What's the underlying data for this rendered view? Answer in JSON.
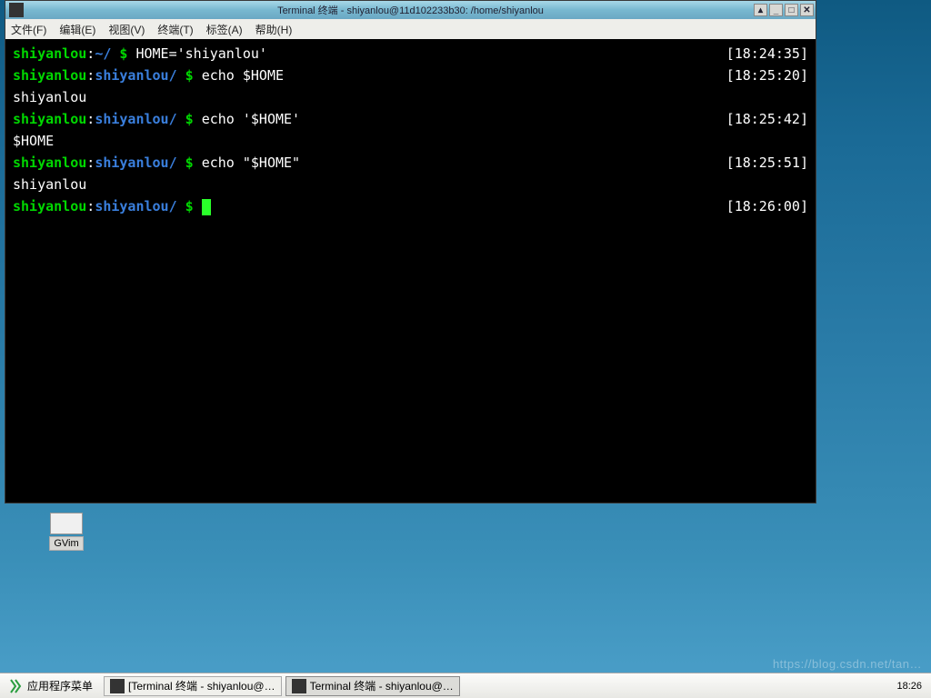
{
  "window": {
    "title": "Terminal 终端 - shiyanlou@11d102233b30: /home/shiyanlou"
  },
  "menubar": {
    "file": "文件(F)",
    "edit": "编辑(E)",
    "view": "视图(V)",
    "terminal": "终端(T)",
    "tabs": "标签(A)",
    "help": "帮助(H)"
  },
  "terminal": {
    "lines": [
      {
        "user": "shiyanlou",
        "path": "~/",
        "cmd": " HOME='shiyanlou'",
        "time": "[18:24:35]"
      },
      {
        "user": "shiyanlou",
        "path": "shiyanlou/",
        "cmd": " echo $HOME",
        "time": "[18:25:20]"
      },
      {
        "output": "shiyanlou"
      },
      {
        "user": "shiyanlou",
        "path": "shiyanlou/",
        "cmd": " echo '$HOME'",
        "time": "[18:25:42]"
      },
      {
        "output": "$HOME"
      },
      {
        "user": "shiyanlou",
        "path": "shiyanlou/",
        "cmd": " echo \"$HOME\"",
        "time": "[18:25:51]"
      },
      {
        "output": "shiyanlou"
      },
      {
        "user": "shiyanlou",
        "path": "shiyanlou/",
        "cmd": " ",
        "time": "[18:26:00]",
        "cursor": true
      }
    ],
    "colon": ":",
    "prompt": " $"
  },
  "desktop": {
    "gvim_label": "GVim"
  },
  "taskbar": {
    "app_menu": "应用程序菜单",
    "item1": "[Terminal 终端 - shiyanlou@…",
    "item2": "Terminal 终端 - shiyanlou@…",
    "clock": "18:26"
  },
  "watermark": "https://blog.csdn.net/tan…"
}
